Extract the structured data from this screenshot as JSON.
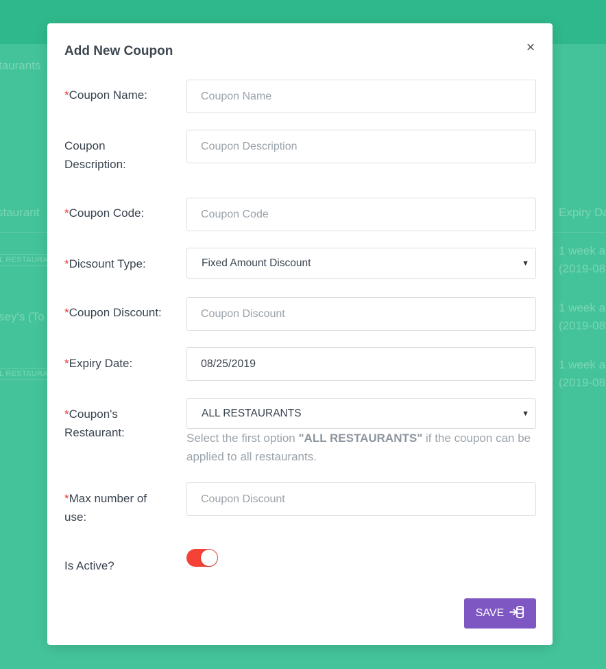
{
  "background": {
    "breadcrumb": "taurants",
    "columns": {
      "restaurant": "staurant",
      "expiry": "Expiry Da"
    },
    "rows": [
      {
        "restaurant": "L RESTAURA",
        "expiry_line1": "1 week a",
        "expiry_line2": "(2019-08"
      },
      {
        "restaurant": "sey's (To",
        "expiry_line1": "1 week a",
        "expiry_line2": "(2019-08"
      },
      {
        "restaurant": "L RESTAURA",
        "expiry_line1": "1 week a",
        "expiry_line2": "(2019-08"
      }
    ]
  },
  "modal": {
    "title": "Add New Coupon",
    "close_icon": "×",
    "required_mark": "*",
    "fields": {
      "coupon_name": {
        "label": "Coupon Name:",
        "placeholder": "Coupon Name",
        "value": ""
      },
      "coupon_description": {
        "label": "Coupon Description:",
        "placeholder": "Coupon Description",
        "value": ""
      },
      "coupon_code": {
        "label": "Coupon Code:",
        "placeholder": "Coupon Code",
        "value": ""
      },
      "discount_type": {
        "label": "Dicsount Type:",
        "selected": "Fixed Amount Discount"
      },
      "coupon_discount": {
        "label": "Coupon Discount:",
        "placeholder": "Coupon Discount",
        "value": ""
      },
      "expiry_date": {
        "label": "Expiry Date:",
        "value": "08/25/2019"
      },
      "coupon_restaurant": {
        "label_line1": "Coupon's",
        "label_line2": "Restaurant:",
        "selected": "ALL RESTAURANTS",
        "help_prefix": "Select the first option ",
        "help_bold": "\"ALL RESTAURANTS\"",
        "help_suffix": " if the coupon can be applied to all restaurants."
      },
      "max_uses": {
        "label": "Max number of use:",
        "placeholder": "Coupon Discount",
        "value": ""
      },
      "is_active": {
        "label": "Is Active?",
        "value": true
      }
    },
    "save_button": {
      "label": "SAVE",
      "icon": "login-icon"
    }
  },
  "colors": {
    "background": "#44c39a",
    "topbar": "#2fb88b",
    "required": "#e53935",
    "toggle_on": "#f44336",
    "save_button": "#7e57c2"
  }
}
